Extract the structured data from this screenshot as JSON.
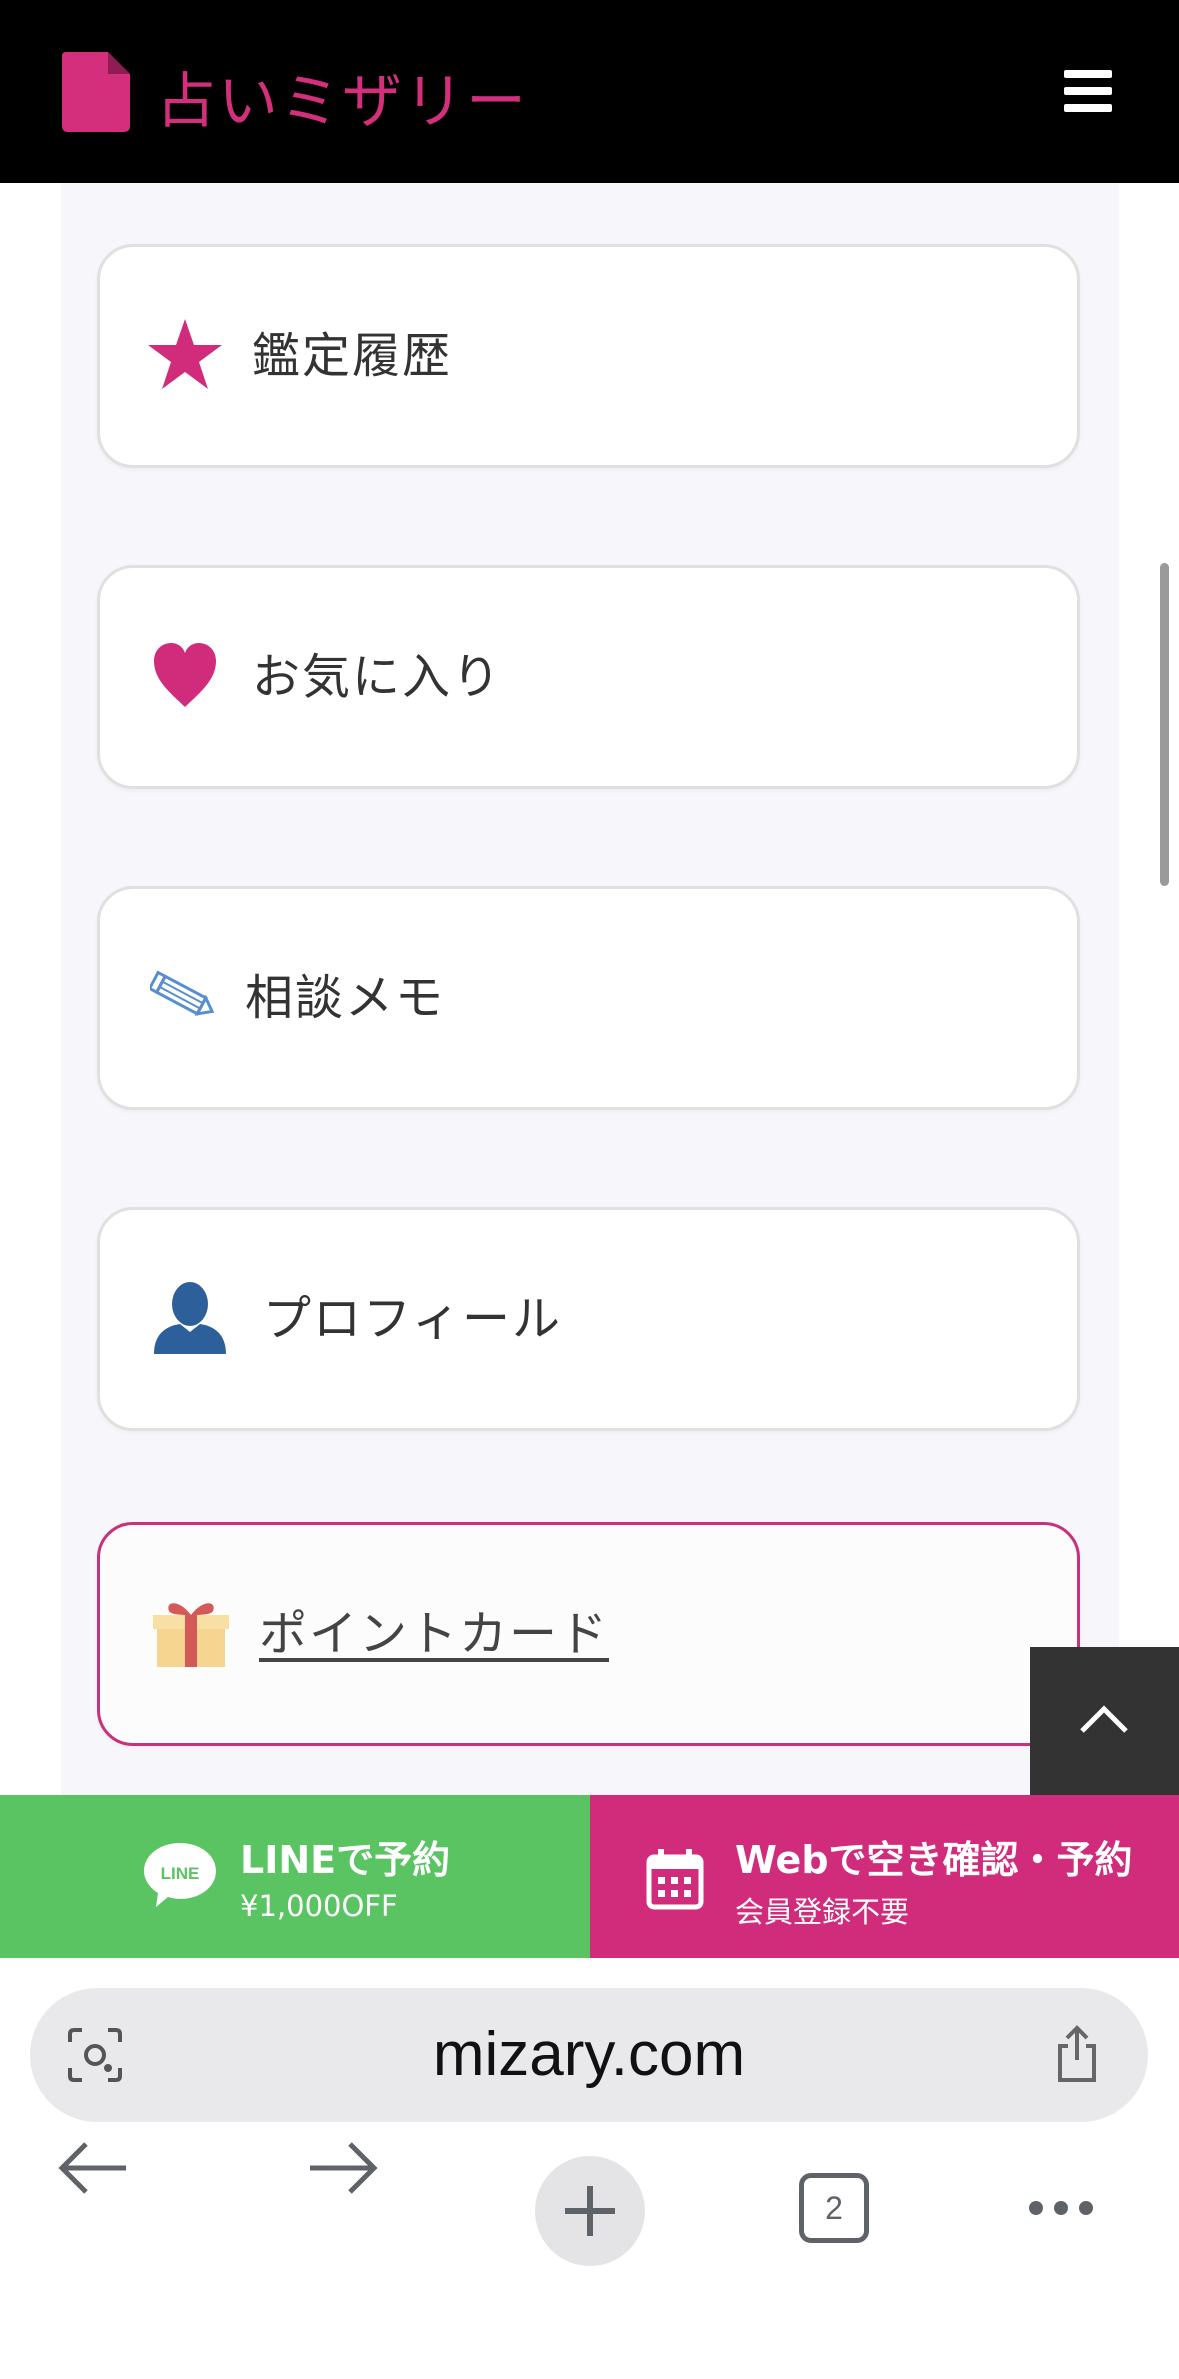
{
  "header": {
    "logo_text": "占いミザリー",
    "brand_color": "#d42f7c"
  },
  "menu": {
    "items": [
      {
        "label": "鑑定履歴",
        "icon": "star-icon"
      },
      {
        "label": "お気に入り",
        "icon": "heart-icon"
      },
      {
        "label": "相談メモ",
        "icon": "pencil-icon"
      },
      {
        "label": "プロフィール",
        "icon": "person-icon"
      },
      {
        "label": "ポイントカード",
        "icon": "gift-icon"
      }
    ]
  },
  "cta": {
    "line": {
      "title": "LINEで予約",
      "sub": "¥1,000OFF",
      "badge": "LINE",
      "color": "#5ac463"
    },
    "web": {
      "title": "Webで空き確認・予約",
      "sub": "会員登録不要",
      "color": "#d12c7c"
    }
  },
  "browser": {
    "url": "mizary.com",
    "tab_count": "2"
  }
}
